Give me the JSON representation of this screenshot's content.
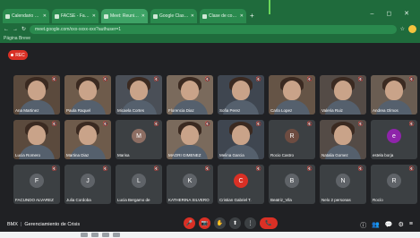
{
  "browser": {
    "tabs": [
      {
        "label": "Calendario aulas UGR - go"
      },
      {
        "label": "FACSE - Facultad de Ciencias"
      },
      {
        "label": "Meet: Reunión - estudiantes"
      },
      {
        "label": "Google Classroom - Inicio"
      },
      {
        "label": "Clase de conexión - equipo"
      }
    ],
    "new_tab": "+",
    "window_controls": "–  ◻  ✕",
    "url": "meet.google.com/xxx-xxxx-xxx?authuser=1",
    "bookmarks_label": "Página Breve"
  },
  "meeting": {
    "rec_label": "REC",
    "name": "BMX",
    "separator": "|",
    "title": "Gerenciamiento de Crisis",
    "controls": [
      "🎤",
      "📷",
      "✋",
      "⬆",
      "⋮",
      "📞"
    ],
    "right_controls": [
      "ⓘ",
      "👥",
      "💬",
      "⚙",
      "≡"
    ]
  },
  "participants": [
    {
      "name": "Ana Martinez",
      "mic": "🔇"
    },
    {
      "name": "Paula Raquel",
      "mic": "🔇"
    },
    {
      "name": "Micaela Cortes",
      "mic": "🔇"
    },
    {
      "name": "Florencia Diaz",
      "mic": "🔇"
    },
    {
      "name": "Sofia Perez",
      "mic": "🔇"
    },
    {
      "name": "Carla Lopez",
      "mic": "🔇"
    },
    {
      "name": "Valeria Ruiz",
      "mic": "🔇"
    },
    {
      "name": "Andrea Olmos",
      "mic": "🔇"
    },
    {
      "name": "Lucia Romero",
      "mic": "🔇"
    },
    {
      "name": "Martina Diaz",
      "mic": "🔇"
    },
    {
      "name": "Marisa",
      "mic": "🔇",
      "avatar": "M",
      "color": "#8d6e63"
    },
    {
      "name": "MAORI GIMENEZ",
      "mic": "🔇"
    },
    {
      "name": "Melina Garcia",
      "mic": "🔇"
    },
    {
      "name": "Rocio Castro",
      "mic": "🔇",
      "avatar": "R",
      "color": "#6d4c41"
    },
    {
      "name": "Natalia Gomez",
      "mic": "🔇"
    },
    {
      "name": "estela borja",
      "mic": "🔇",
      "avatar": "e",
      "color": "#8e24aa"
    },
    {
      "name": "FACUNDO ALVAREZ",
      "mic": "🔇",
      "avatar": "F",
      "color": "#5f6368"
    },
    {
      "name": "Julia Cordoba",
      "mic": "🔇",
      "avatar": "J",
      "color": "#5f6368"
    },
    {
      "name": "Lucia Bergamo de",
      "mic": "🔇",
      "avatar": "L",
      "color": "#5f6368"
    },
    {
      "name": "KATHERINA SILVERO",
      "mic": "🔇",
      "avatar": "K",
      "color": "#5f6368"
    },
    {
      "name": "Cristian Gabriel T.",
      "mic": "🔇",
      "avatar": "C",
      "color": "#d93025"
    },
    {
      "name": "Beatriz_Vila",
      "mic": "🔇",
      "avatar": "B",
      "color": "#5f6368"
    },
    {
      "name": "Nelo 2 personas",
      "mic": "🔇",
      "avatar": "N",
      "color": "#5f6368"
    },
    {
      "name": "Rocío",
      "mic": "🔇",
      "avatar": "R",
      "color": "#5f6368"
    }
  ]
}
